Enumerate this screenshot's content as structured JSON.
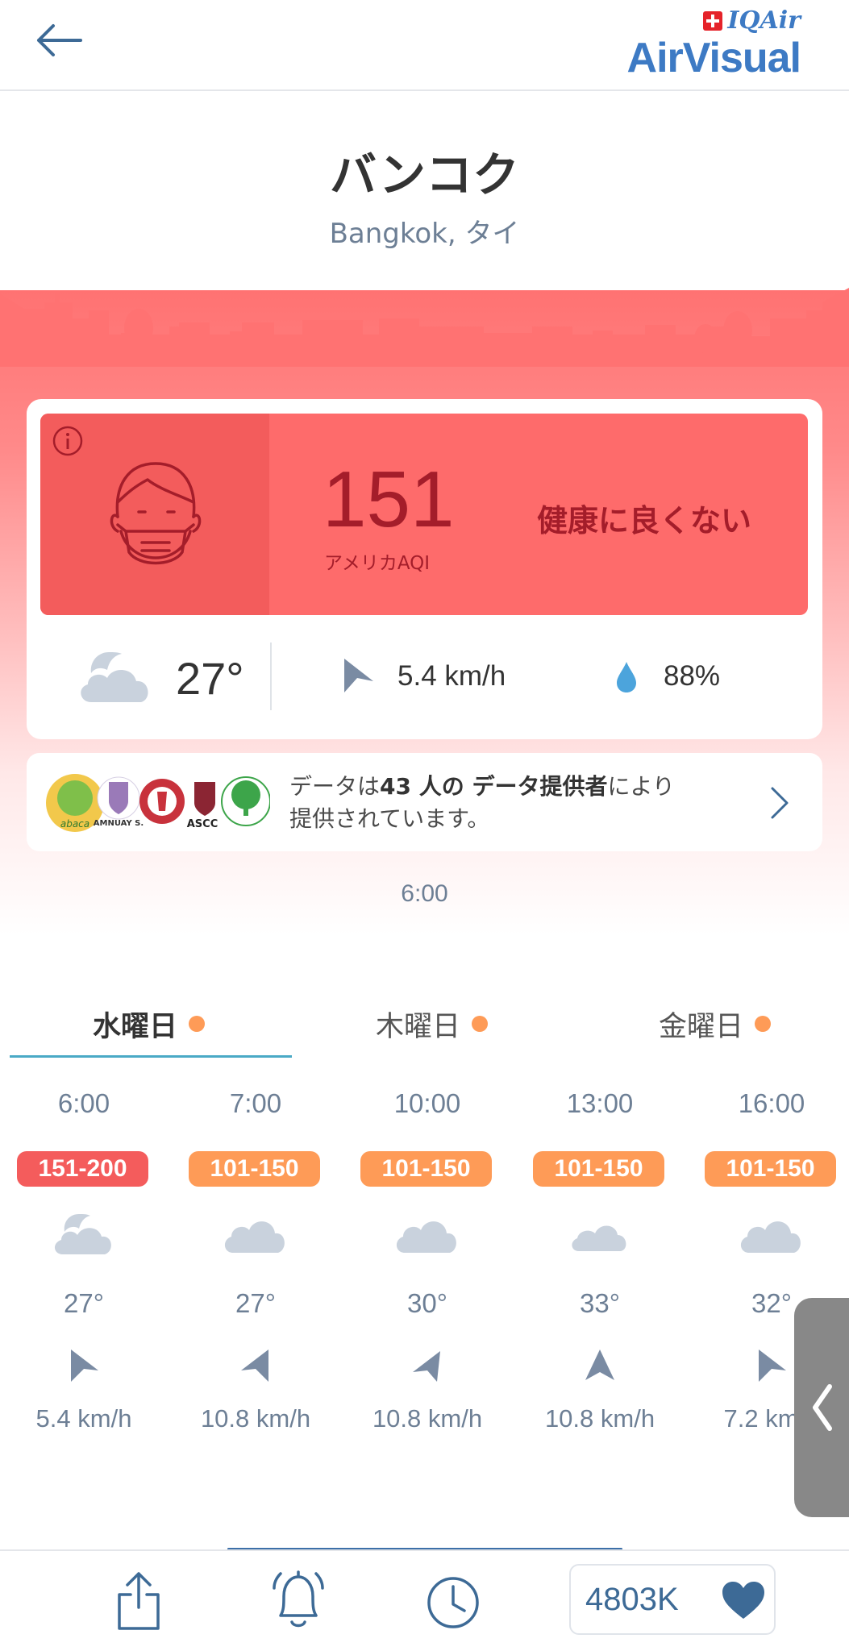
{
  "header": {
    "back_icon": "back-arrow-icon",
    "brand_top": "IQAir",
    "brand_name": "AirVisual"
  },
  "location": {
    "city": "バンコク",
    "subtitle": "Bangkok, タイ"
  },
  "aqi": {
    "value": "151",
    "unit_label": "アメリカAQI",
    "status": "健康に良くない",
    "color": "#fe6b6b",
    "text_color": "#a41d2a"
  },
  "current_weather": {
    "icon": "partly-cloudy-night-icon",
    "temperature": "27°",
    "wind_speed": "5.4 km/h",
    "humidity": "88%"
  },
  "contributors": {
    "text_pre": "データは",
    "text_bold": "43 人の データ提供者",
    "text_post1": "により",
    "text_line2": "提供されています。",
    "logos": [
      {
        "name": "abaca",
        "text": "abaca",
        "color": "#7fbf4a"
      },
      {
        "name": "amnuay",
        "text": "AMNUAY S.",
        "color": "#9a7ab8"
      },
      {
        "name": "red-crest",
        "text": "",
        "color": "#c8323c"
      },
      {
        "name": "ascc",
        "text": "ASCC",
        "color": "#8b2533"
      },
      {
        "name": "tree",
        "text": "",
        "color": "#3da54a"
      }
    ]
  },
  "update_time": "6:00",
  "day_tabs": [
    {
      "label": "水曜日",
      "active": true
    },
    {
      "label": "木曜日",
      "active": false
    },
    {
      "label": "金曜日",
      "active": false
    }
  ],
  "hourly": [
    {
      "time": "6:00",
      "aqi_range": "151-200",
      "badge_color": "#f45c5c",
      "icon": "partly-cloudy-night-icon",
      "temp": "27°",
      "wind": "5.4 km/h",
      "wind_dir": "east"
    },
    {
      "time": "7:00",
      "aqi_range": "101-150",
      "badge_color": "#fe9b57",
      "icon": "cloud-icon",
      "temp": "27°",
      "wind": "10.8 km/h",
      "wind_dir": "west"
    },
    {
      "time": "10:00",
      "aqi_range": "101-150",
      "badge_color": "#fe9b57",
      "icon": "cloud-icon",
      "temp": "30°",
      "wind": "10.8 km/h",
      "wind_dir": "west"
    },
    {
      "time": "13:00",
      "aqi_range": "101-150",
      "badge_color": "#fe9b57",
      "icon": "cloud-icon",
      "temp": "33°",
      "wind": "10.8 km/h",
      "wind_dir": "north"
    },
    {
      "time": "16:00",
      "aqi_range": "101-150",
      "badge_color": "#fe9b57",
      "icon": "cloud-icon",
      "temp": "32°",
      "wind": "7.2 km/h",
      "wind_dir": "east"
    }
  ],
  "bottom_bar": {
    "share_icon": "share-icon",
    "alert_icon": "bell-icon",
    "history_icon": "clock-icon",
    "like_count": "4803K",
    "like_icon": "heart-icon"
  }
}
